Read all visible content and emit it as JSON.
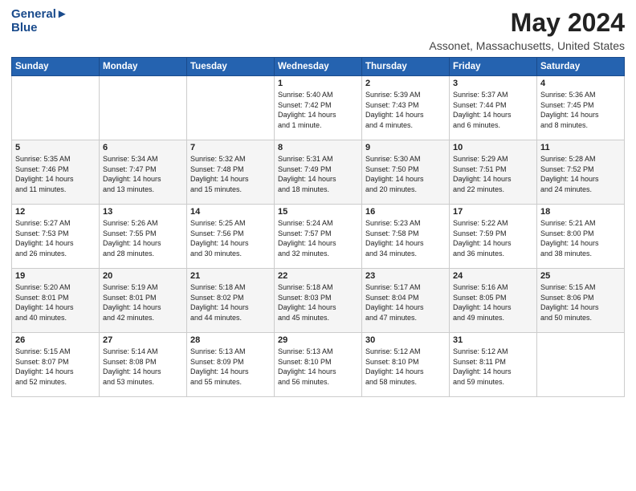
{
  "header": {
    "logo_line1": "General",
    "logo_line2": "Blue",
    "title": "May 2024",
    "subtitle": "Assonet, Massachusetts, United States"
  },
  "weekdays": [
    "Sunday",
    "Monday",
    "Tuesday",
    "Wednesday",
    "Thursday",
    "Friday",
    "Saturday"
  ],
  "weeks": [
    [
      {
        "day": "",
        "info": ""
      },
      {
        "day": "",
        "info": ""
      },
      {
        "day": "",
        "info": ""
      },
      {
        "day": "1",
        "info": "Sunrise: 5:40 AM\nSunset: 7:42 PM\nDaylight: 14 hours\nand 1 minute."
      },
      {
        "day": "2",
        "info": "Sunrise: 5:39 AM\nSunset: 7:43 PM\nDaylight: 14 hours\nand 4 minutes."
      },
      {
        "day": "3",
        "info": "Sunrise: 5:37 AM\nSunset: 7:44 PM\nDaylight: 14 hours\nand 6 minutes."
      },
      {
        "day": "4",
        "info": "Sunrise: 5:36 AM\nSunset: 7:45 PM\nDaylight: 14 hours\nand 8 minutes."
      }
    ],
    [
      {
        "day": "5",
        "info": "Sunrise: 5:35 AM\nSunset: 7:46 PM\nDaylight: 14 hours\nand 11 minutes."
      },
      {
        "day": "6",
        "info": "Sunrise: 5:34 AM\nSunset: 7:47 PM\nDaylight: 14 hours\nand 13 minutes."
      },
      {
        "day": "7",
        "info": "Sunrise: 5:32 AM\nSunset: 7:48 PM\nDaylight: 14 hours\nand 15 minutes."
      },
      {
        "day": "8",
        "info": "Sunrise: 5:31 AM\nSunset: 7:49 PM\nDaylight: 14 hours\nand 18 minutes."
      },
      {
        "day": "9",
        "info": "Sunrise: 5:30 AM\nSunset: 7:50 PM\nDaylight: 14 hours\nand 20 minutes."
      },
      {
        "day": "10",
        "info": "Sunrise: 5:29 AM\nSunset: 7:51 PM\nDaylight: 14 hours\nand 22 minutes."
      },
      {
        "day": "11",
        "info": "Sunrise: 5:28 AM\nSunset: 7:52 PM\nDaylight: 14 hours\nand 24 minutes."
      }
    ],
    [
      {
        "day": "12",
        "info": "Sunrise: 5:27 AM\nSunset: 7:53 PM\nDaylight: 14 hours\nand 26 minutes."
      },
      {
        "day": "13",
        "info": "Sunrise: 5:26 AM\nSunset: 7:55 PM\nDaylight: 14 hours\nand 28 minutes."
      },
      {
        "day": "14",
        "info": "Sunrise: 5:25 AM\nSunset: 7:56 PM\nDaylight: 14 hours\nand 30 minutes."
      },
      {
        "day": "15",
        "info": "Sunrise: 5:24 AM\nSunset: 7:57 PM\nDaylight: 14 hours\nand 32 minutes."
      },
      {
        "day": "16",
        "info": "Sunrise: 5:23 AM\nSunset: 7:58 PM\nDaylight: 14 hours\nand 34 minutes."
      },
      {
        "day": "17",
        "info": "Sunrise: 5:22 AM\nSunset: 7:59 PM\nDaylight: 14 hours\nand 36 minutes."
      },
      {
        "day": "18",
        "info": "Sunrise: 5:21 AM\nSunset: 8:00 PM\nDaylight: 14 hours\nand 38 minutes."
      }
    ],
    [
      {
        "day": "19",
        "info": "Sunrise: 5:20 AM\nSunset: 8:01 PM\nDaylight: 14 hours\nand 40 minutes."
      },
      {
        "day": "20",
        "info": "Sunrise: 5:19 AM\nSunset: 8:01 PM\nDaylight: 14 hours\nand 42 minutes."
      },
      {
        "day": "21",
        "info": "Sunrise: 5:18 AM\nSunset: 8:02 PM\nDaylight: 14 hours\nand 44 minutes."
      },
      {
        "day": "22",
        "info": "Sunrise: 5:18 AM\nSunset: 8:03 PM\nDaylight: 14 hours\nand 45 minutes."
      },
      {
        "day": "23",
        "info": "Sunrise: 5:17 AM\nSunset: 8:04 PM\nDaylight: 14 hours\nand 47 minutes."
      },
      {
        "day": "24",
        "info": "Sunrise: 5:16 AM\nSunset: 8:05 PM\nDaylight: 14 hours\nand 49 minutes."
      },
      {
        "day": "25",
        "info": "Sunrise: 5:15 AM\nSunset: 8:06 PM\nDaylight: 14 hours\nand 50 minutes."
      }
    ],
    [
      {
        "day": "26",
        "info": "Sunrise: 5:15 AM\nSunset: 8:07 PM\nDaylight: 14 hours\nand 52 minutes."
      },
      {
        "day": "27",
        "info": "Sunrise: 5:14 AM\nSunset: 8:08 PM\nDaylight: 14 hours\nand 53 minutes."
      },
      {
        "day": "28",
        "info": "Sunrise: 5:13 AM\nSunset: 8:09 PM\nDaylight: 14 hours\nand 55 minutes."
      },
      {
        "day": "29",
        "info": "Sunrise: 5:13 AM\nSunset: 8:10 PM\nDaylight: 14 hours\nand 56 minutes."
      },
      {
        "day": "30",
        "info": "Sunrise: 5:12 AM\nSunset: 8:10 PM\nDaylight: 14 hours\nand 58 minutes."
      },
      {
        "day": "31",
        "info": "Sunrise: 5:12 AM\nSunset: 8:11 PM\nDaylight: 14 hours\nand 59 minutes."
      },
      {
        "day": "",
        "info": ""
      }
    ]
  ]
}
